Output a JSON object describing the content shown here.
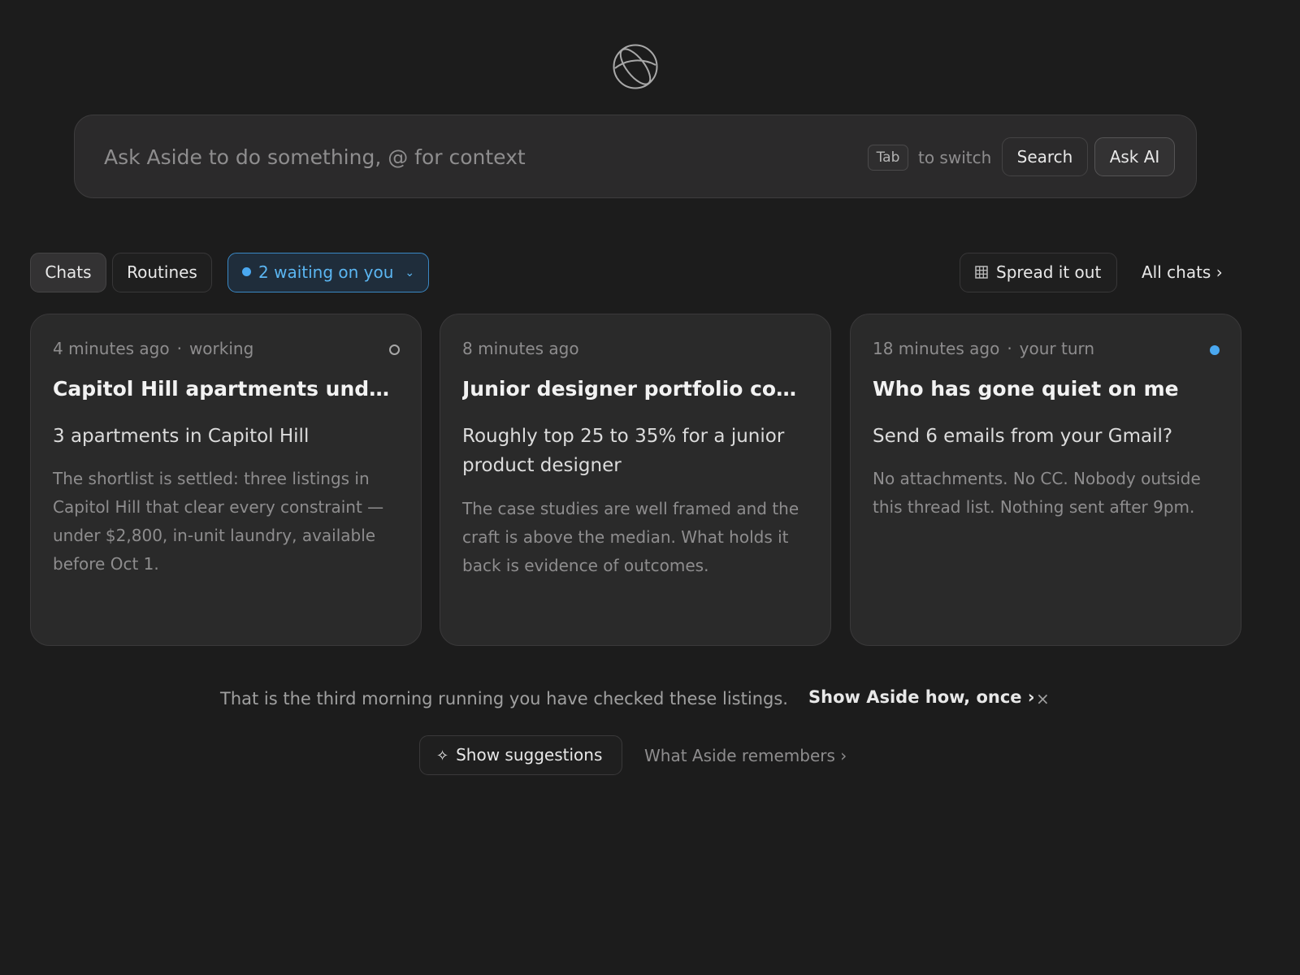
{
  "logo": {
    "icon": "aside-logo-icon"
  },
  "prompt": {
    "placeholder": "Ask Aside to do something, @ for context",
    "tab_key": "Tab",
    "switch_hint": "to switch",
    "search_label": "Search",
    "ask_label": "Ask AI"
  },
  "filters": {
    "chats": "Chats",
    "routines": "Routines",
    "waiting": "2 waiting on you",
    "spread": "Spread it out",
    "all_chats": "All chats ›"
  },
  "cards": [
    {
      "time": "4 minutes ago",
      "status": "working",
      "title": "Capitol Hill apartments under $...",
      "subtitle": "3 apartments in Capitol Hill",
      "body": "The shortlist is settled: three listings in Capitol Hill that clear every constraint — under $2,800, in‑unit laundry, available before Oct 1.",
      "indicator": "ring"
    },
    {
      "time": "8 minutes ago",
      "status": "",
      "title": "Junior designer portfolio comp...",
      "subtitle": "Roughly top 25 to 35% for a junior product designer",
      "body": "The case studies are well framed and the craft is above the median. What holds it back is evidence of outcomes.",
      "indicator": "none"
    },
    {
      "time": "18 minutes ago",
      "status": "your turn",
      "title": "Who has gone quiet on me",
      "subtitle": "Send 6 emails from your Gmail?",
      "body": "No attachments. No CC. Nobody outside this thread list. Nothing sent after 9pm.",
      "indicator": "blue-dot"
    }
  ],
  "nudge": {
    "text": "That is the third morning running you have checked these listings.",
    "link": "Show Aside how, once ›",
    "close": "×"
  },
  "footer": {
    "suggestions": "Show suggestions",
    "remembers": "What Aside remembers ›"
  },
  "colors": {
    "background": "#1c1c1c",
    "accent": "#4aa8f0",
    "card": "#2a2a2a"
  }
}
